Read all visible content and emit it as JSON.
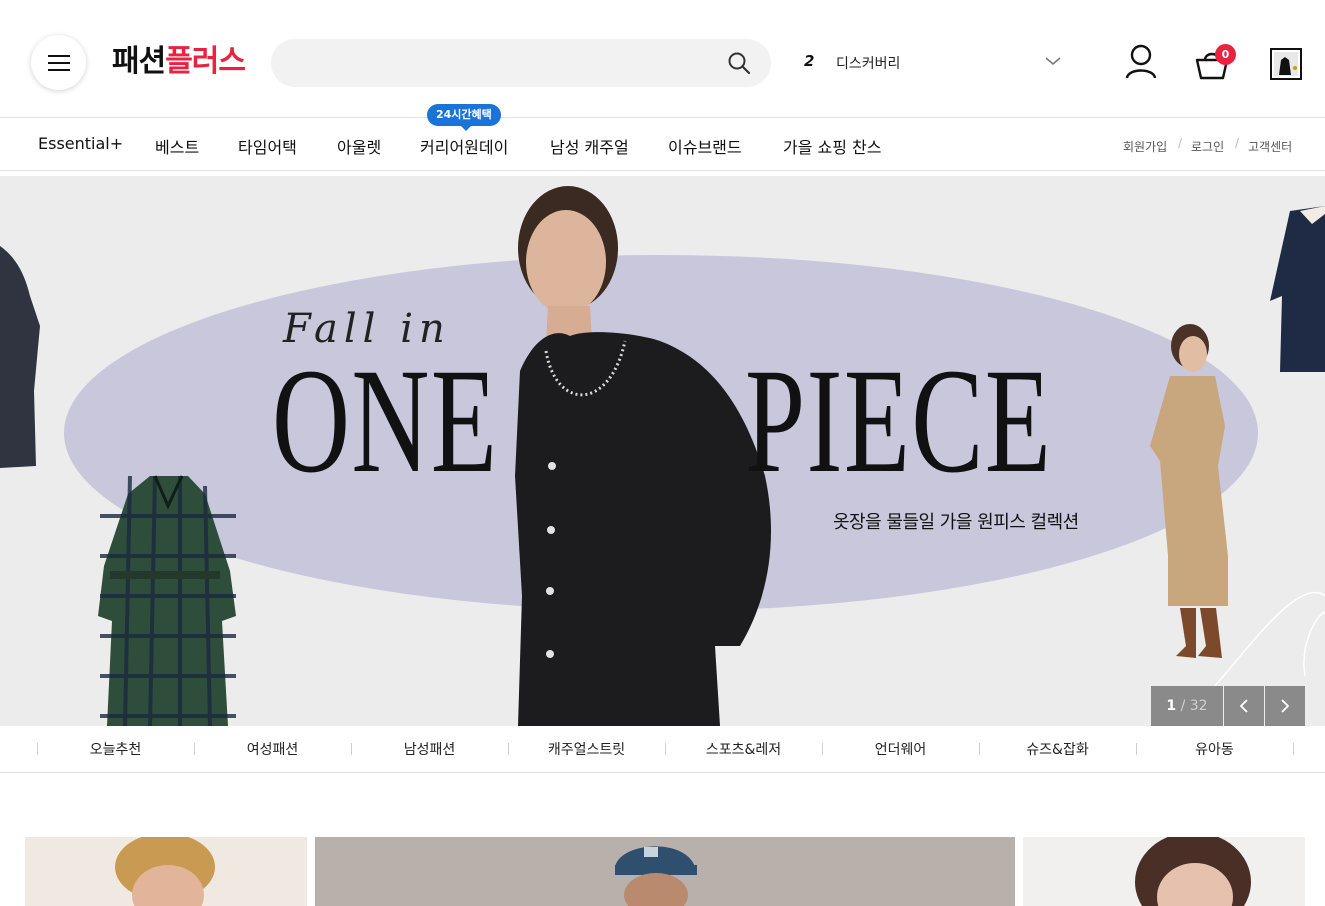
{
  "header": {
    "logo_part1": "패션",
    "logo_part2": "플러스",
    "search_placeholder": "",
    "trending_rank": "2",
    "trending_keyword": "디스커버리",
    "cart_count": "0"
  },
  "gnb": {
    "items": [
      "Essential+",
      "베스트",
      "타임어택",
      "아울렛",
      "커리어원데이",
      "남성 캐주얼",
      "이슈브랜드",
      "가을 쇼핑 찬스"
    ],
    "badge": "24시간혜택",
    "util": [
      "회원가입",
      "로그인",
      "고객센터"
    ],
    "util_sep": "/"
  },
  "hero": {
    "script_text": "Fall in",
    "title_left": "ONE",
    "title_right": "PIECE",
    "subtitle": "옷장을 물들일 가을 원피스 컬렉션",
    "page_current": "1",
    "page_total": "/ 32",
    "colors": {
      "background": "#ececed",
      "ellipse": "#c9c7dc",
      "dress_black": "#1c1c1f",
      "plaid": "#2e4d3a",
      "trench": "#c9a77e"
    }
  },
  "categories": [
    "오늘추천",
    "여성패션",
    "남성패션",
    "캐주얼스트릿",
    "스포츠&레저",
    "언더웨어",
    "슈즈&잡화",
    "유아동"
  ],
  "icons": [
    "hamburger-icon",
    "search-icon",
    "chevron-down-icon",
    "user-icon",
    "cart-icon",
    "recent-item-icon",
    "chevron-left-icon",
    "chevron-right-icon"
  ]
}
